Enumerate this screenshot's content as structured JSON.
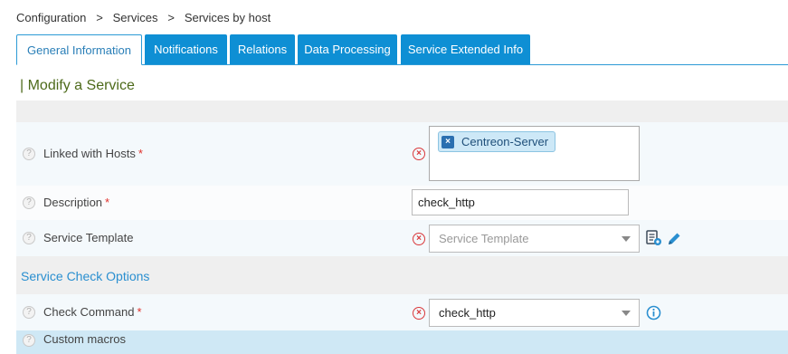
{
  "breadcrumb": {
    "items": [
      "Configuration",
      "Services",
      "Services by host"
    ],
    "separator": ">"
  },
  "tabs": [
    {
      "label": "General Information",
      "active": true
    },
    {
      "label": "Notifications",
      "active": false
    },
    {
      "label": "Relations",
      "active": false
    },
    {
      "label": "Data Processing",
      "active": false
    },
    {
      "label": "Service Extended Info",
      "active": false
    }
  ],
  "form": {
    "title": "| Modify a Service",
    "help_glyph": "?",
    "required_mark": "*",
    "clear_glyph": "×",
    "linked_hosts": {
      "label": "Linked with Hosts",
      "selected": [
        "Centreon-Server"
      ]
    },
    "description": {
      "label": "Description",
      "value": "check_http"
    },
    "service_template": {
      "label": "Service Template",
      "placeholder": "Service Template",
      "icons": [
        "template-list-icon",
        "edit-pencil-icon"
      ]
    },
    "section_check_options": "Service Check Options",
    "check_command": {
      "label": "Check Command",
      "value": "check_http",
      "info_icon": "info-icon"
    },
    "custom_macros": {
      "label": "Custom macros"
    }
  },
  "colors": {
    "tab_blue": "#0e8fd4",
    "title_green": "#4d6a1a",
    "section_blue": "#2a8fd0",
    "required_red": "#e0312b"
  }
}
